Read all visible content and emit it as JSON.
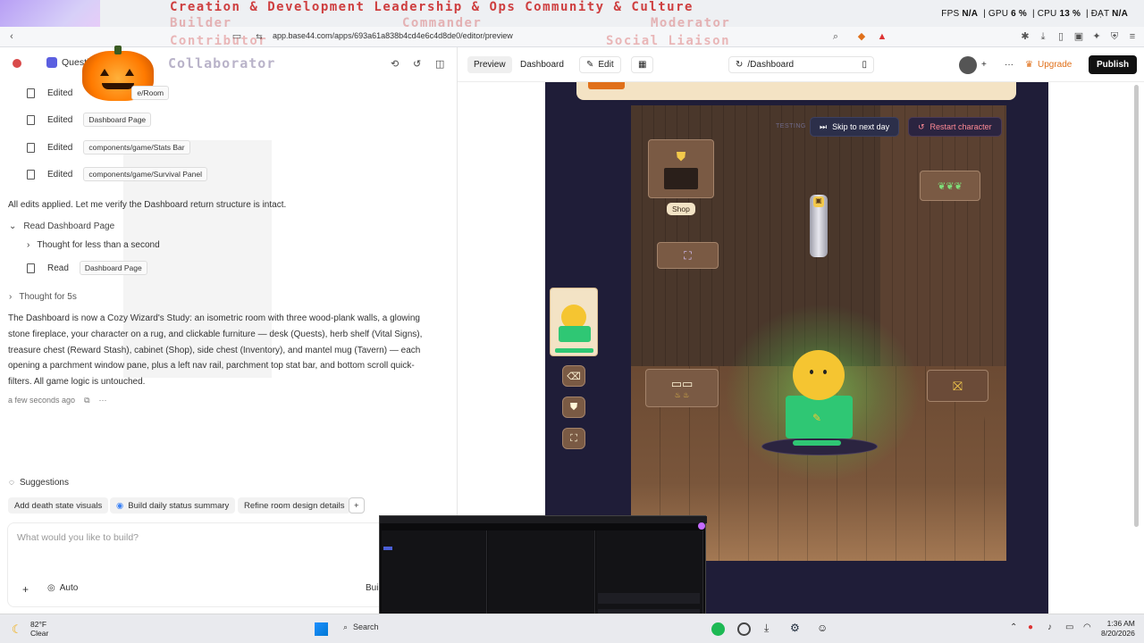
{
  "browser": {
    "url": "app.base44.com/apps/693a61a838b4cd4e6c4d8de0/editor/preview",
    "hud": {
      "fps_label": "FPS",
      "fps": "N/A",
      "gpu_label": "GPU",
      "gpu": "6 %",
      "cpu_label": "CPU",
      "cpu": "13 %",
      "dat_label": "ĐẠT",
      "dat": "N/A"
    }
  },
  "overlay": {
    "line1": [
      "Creation",
      "&",
      "Development",
      "Leadership",
      "&",
      "Ops",
      "Community",
      "&",
      "Culture"
    ],
    "builder": "Builder",
    "commander": "Commander",
    "moderator": "Moderator",
    "contributor": "Contributor",
    "social_liaison": "Social Liaison",
    "collaborator": "Collaborator"
  },
  "app": {
    "name": "Questify",
    "edits": [
      {
        "verb": "Edited",
        "target": "e/Room"
      },
      {
        "verb": "Edited",
        "target": "Dashboard Page"
      },
      {
        "verb": "Edited",
        "target": "components/game/Stats Bar"
      },
      {
        "verb": "Edited",
        "target": "components/game/Survival Panel"
      }
    ],
    "applied_msg": "All edits applied. Let me verify the Dashboard return structure is intact.",
    "read_section": {
      "title": "Read Dashboard Page",
      "thought": "Thought for less than a second",
      "verb": "Read",
      "target": "Dashboard Page"
    },
    "thought5": "Thought for 5s",
    "summary": "The Dashboard is now a Cozy Wizard's Study: an isometric room with three wood-plank walls, a glowing stone fireplace, your character on a rug, and clickable furniture — desk (Quests), herb shelf (Vital Signs), treasure chest (Reward Stash), cabinet (Shop), side chest (Inventory), and mantel mug (Tavern) — each opening a parchment window pane, plus a left nav rail, parchment top stat bar, and bottom scroll quick-filters. All game logic is untouched.",
    "timestamp": "a few seconds ago",
    "suggestions_title": "Suggestions",
    "suggestions": [
      "Add death state visuals",
      "Build daily status summary",
      "Refine room design details"
    ],
    "prompt_placeholder": "What would you like to build?",
    "mode": "Auto",
    "build_cut": "Bui"
  },
  "toolbar": {
    "preview": "Preview",
    "dashboard": "Dashboard",
    "edit": "Edit",
    "route": "/Dashboard",
    "upgrade": "Upgrade",
    "publish": "Publish"
  },
  "game": {
    "testing": "TESTING",
    "skip": "Skip to next day",
    "restart": "Restart character",
    "shop_label": "Shop"
  },
  "taskbar": {
    "temp": "82°F",
    "weather": "Clear",
    "search": "Search",
    "time": "1:36 AM",
    "date": "8/20/2026"
  },
  "colors": {
    "publish_bg": "#111111",
    "upgrade": "#e0701a",
    "restart": "#ff6b7a",
    "char_body": "#2fc774",
    "char_head": "#f5c531",
    "game_bg": "#1f1d38"
  }
}
